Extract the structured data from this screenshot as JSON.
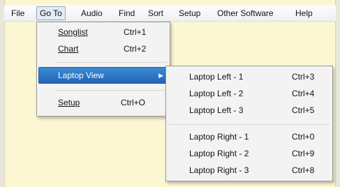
{
  "menubar": {
    "items": [
      {
        "label": "File"
      },
      {
        "label": "Go To"
      },
      {
        "label": "Audio"
      },
      {
        "label": "Find"
      },
      {
        "label": "Sort"
      },
      {
        "label": "Setup"
      },
      {
        "label": "Other Software"
      },
      {
        "label": "Help"
      }
    ]
  },
  "goto_menu": {
    "items": [
      {
        "label": "Songlist",
        "shortcut": "Ctrl+1"
      },
      {
        "label": "Chart",
        "shortcut": "Ctrl+2"
      },
      {
        "label": "Laptop View",
        "submenu_icon": "triangle-right-icon"
      },
      {
        "label": "Setup",
        "shortcut": "Ctrl+O"
      }
    ]
  },
  "laptop_submenu": {
    "items": [
      {
        "label": "Laptop Left - 1",
        "shortcut": "Ctrl+3"
      },
      {
        "label": "Laptop Left - 2",
        "shortcut": "Ctrl+4"
      },
      {
        "label": "Laptop Left - 3",
        "shortcut": "Ctrl+5"
      },
      {
        "label": "Laptop Right - 1",
        "shortcut": "Ctrl+0"
      },
      {
        "label": "Laptop Right - 2",
        "shortcut": "Ctrl+9"
      },
      {
        "label": "Laptop Right - 3",
        "shortcut": "Ctrl+8"
      }
    ]
  },
  "colors": {
    "background": "#fbf7d2",
    "highlight": "#2a72c2"
  }
}
